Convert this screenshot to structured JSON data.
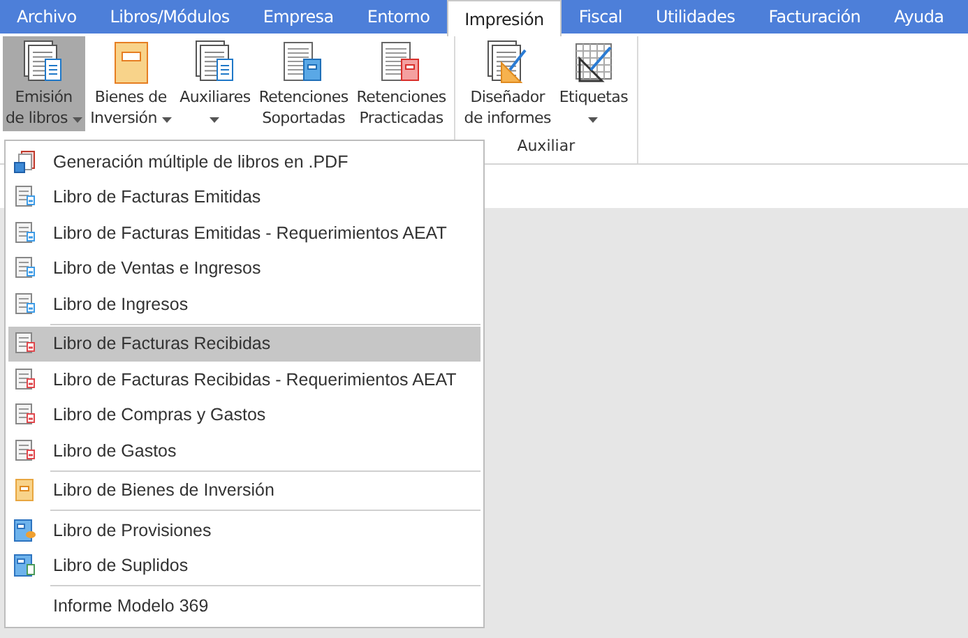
{
  "tabs": [
    {
      "label": "Archivo",
      "selected": false
    },
    {
      "label": "Libros/Módulos",
      "selected": false
    },
    {
      "label": "Empresa",
      "selected": false
    },
    {
      "label": "Entorno",
      "selected": false
    },
    {
      "label": "Impresión",
      "selected": true
    },
    {
      "label": "Fiscal",
      "selected": false
    },
    {
      "label": "Utilidades",
      "selected": false
    },
    {
      "label": "Facturación",
      "selected": false
    },
    {
      "label": "Ayuda",
      "selected": false
    }
  ],
  "ribbon": {
    "groups": [
      {
        "buttons": [
          {
            "kind": "stack",
            "lines": [
              "Emisión",
              "de libros"
            ],
            "dropdown": true,
            "selected": true
          },
          {
            "kind": "book",
            "lines": [
              "Bienes de",
              "Inversión"
            ],
            "dropdown": true,
            "selected": false
          },
          {
            "kind": "stack",
            "lines": [
              "Auxiliares"
            ],
            "dropdown": true,
            "selected": false
          },
          {
            "kind": "doc-blue",
            "lines": [
              "Retenciones",
              "Soportadas"
            ],
            "dropdown": false,
            "selected": false
          },
          {
            "kind": "doc-red",
            "lines": [
              "Retenciones",
              "Practicadas"
            ],
            "dropdown": false,
            "selected": false
          }
        ]
      },
      {
        "label": "Auxiliar",
        "buttons": [
          {
            "kind": "designer",
            "lines": [
              "Diseñador",
              "de informes"
            ],
            "dropdown": false,
            "selected": false
          },
          {
            "kind": "grid",
            "lines": [
              "Etiquetas"
            ],
            "dropdown": true,
            "selected": false
          }
        ]
      }
    ]
  },
  "menu": {
    "sections": [
      {
        "items": [
          {
            "kind": "pdf",
            "label": "Generación múltiple de libros en .PDF",
            "selected": false
          },
          {
            "kind": "doc-blue",
            "label": "Libro de Facturas Emitidas",
            "selected": false
          },
          {
            "kind": "doc-blue",
            "label": "Libro de Facturas Emitidas - Requerimientos AEAT",
            "selected": false
          },
          {
            "kind": "doc-blue",
            "label": "Libro de Ventas e Ingresos",
            "selected": false
          },
          {
            "kind": "doc-blue",
            "label": "Libro de Ingresos",
            "selected": false
          }
        ]
      },
      {
        "items": [
          {
            "kind": "doc-red",
            "label": "Libro de Facturas Recibidas",
            "selected": true
          },
          {
            "kind": "doc-red",
            "label": "Libro de Facturas Recibidas - Requerimientos AEAT",
            "selected": false
          },
          {
            "kind": "doc-red",
            "label": "Libro de Compras y Gastos",
            "selected": false
          },
          {
            "kind": "doc-red",
            "label": "Libro de Gastos",
            "selected": false
          }
        ]
      },
      {
        "items": [
          {
            "kind": "book",
            "label": "Libro de Bienes de Inversión",
            "selected": false
          }
        ]
      },
      {
        "items": [
          {
            "kind": "book-hand",
            "label": "Libro de Provisiones",
            "selected": false
          },
          {
            "kind": "book-doc",
            "label": "Libro de Suplidos",
            "selected": false
          }
        ]
      },
      {
        "items": [
          {
            "kind": "none",
            "label": "Informe Modelo 369",
            "selected": false
          }
        ]
      }
    ]
  }
}
